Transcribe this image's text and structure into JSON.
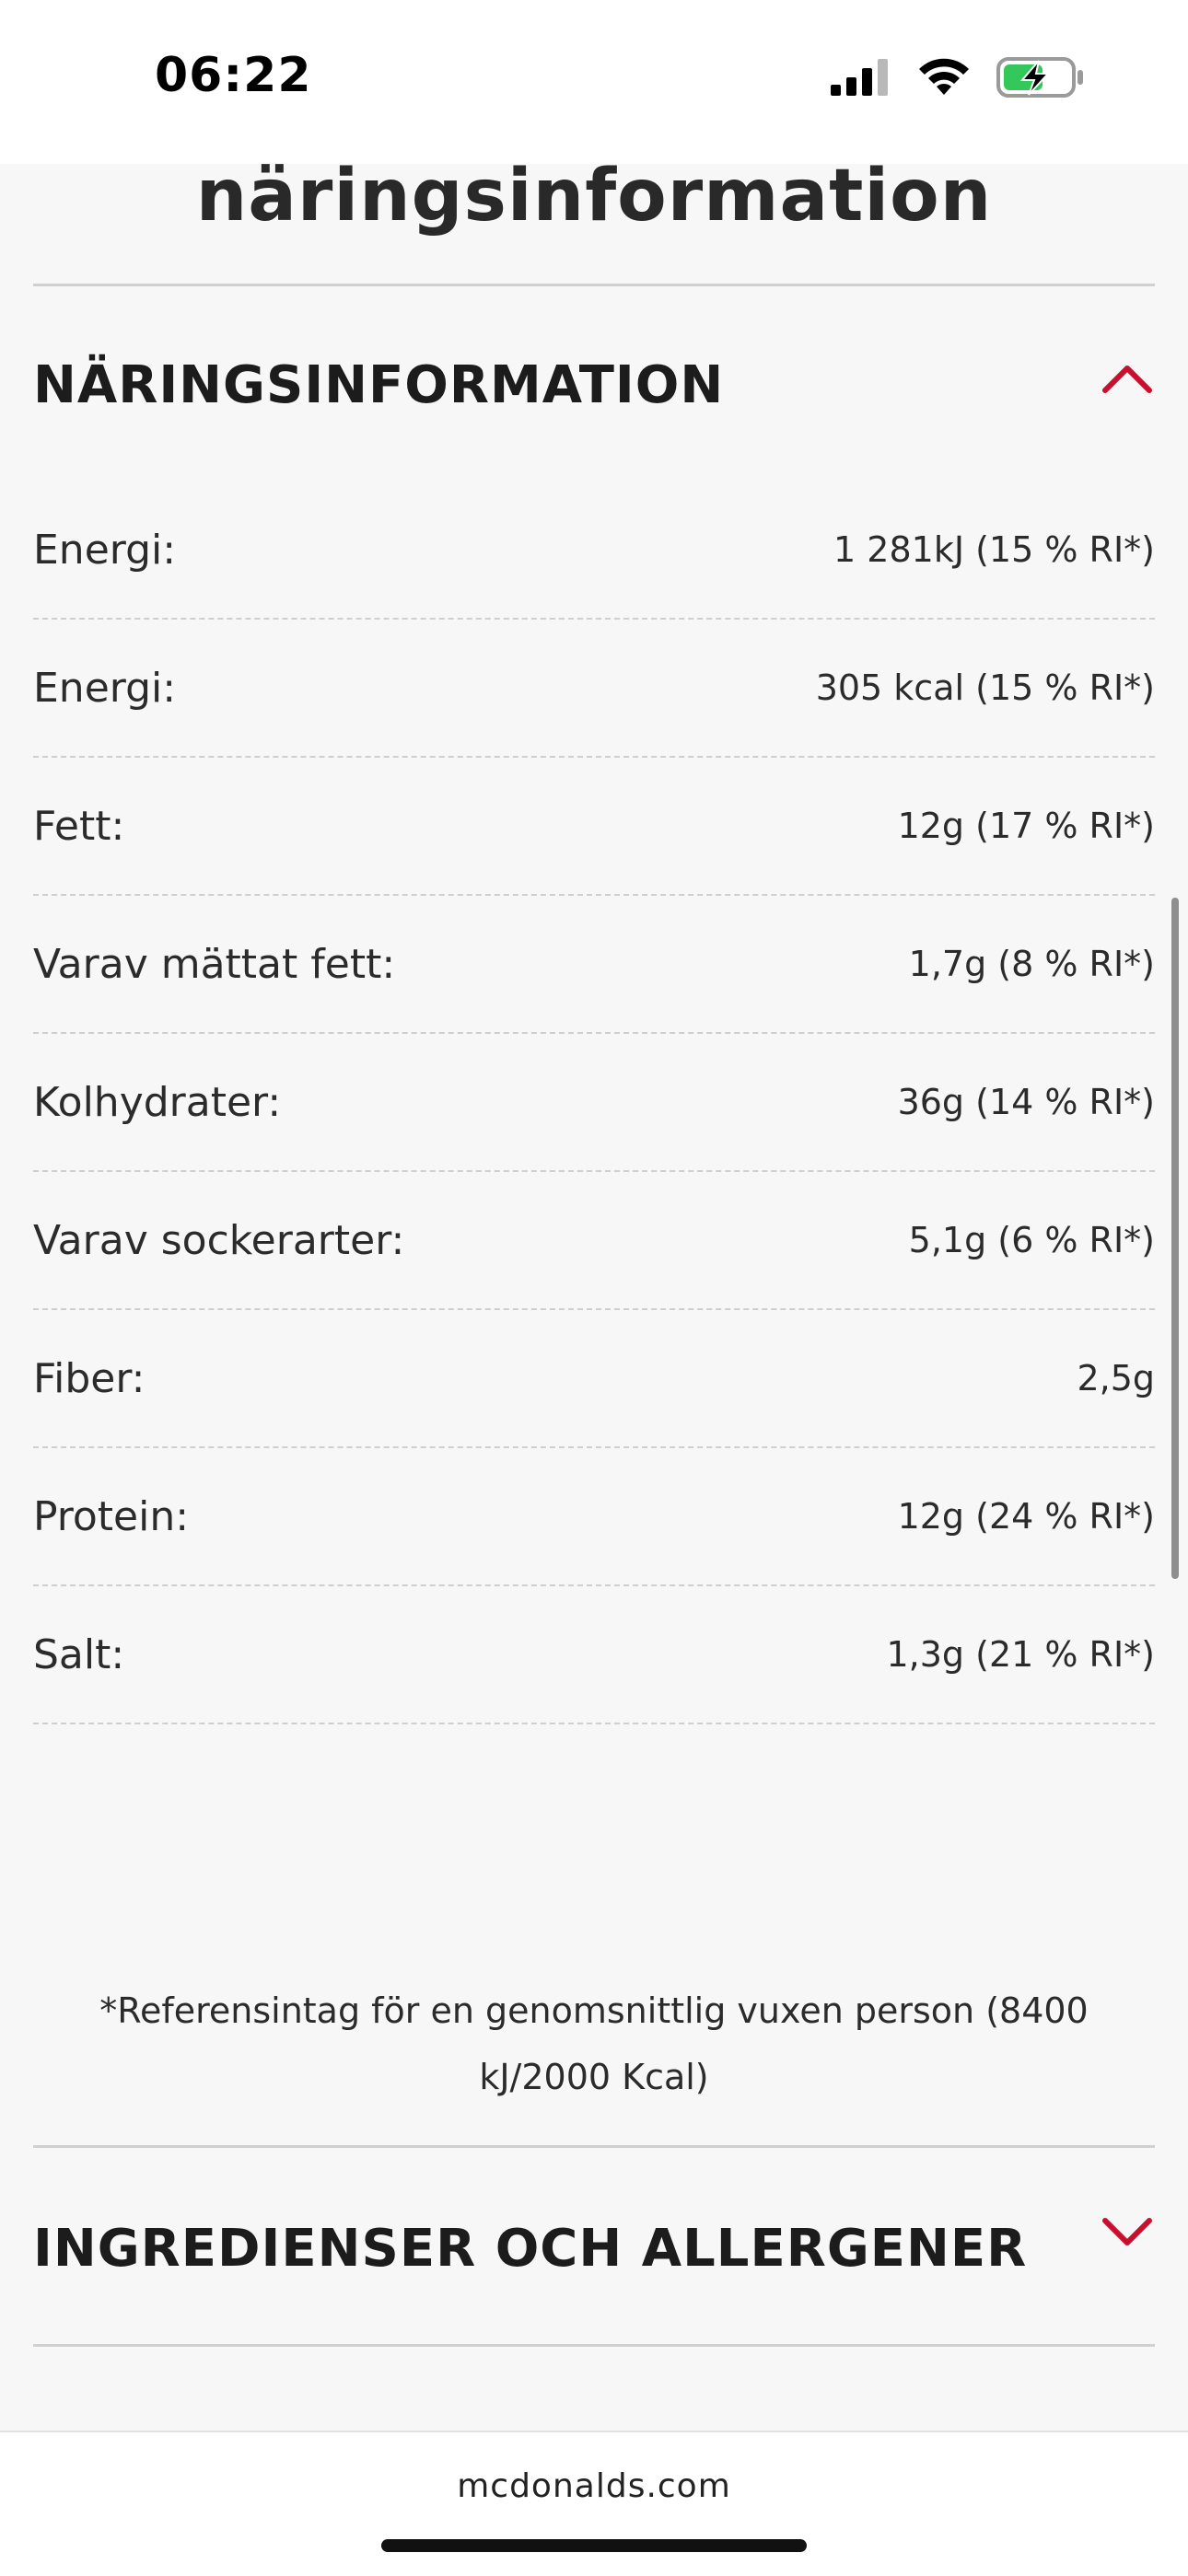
{
  "status_bar": {
    "time": "06:22"
  },
  "page": {
    "heading": "näringsinformation"
  },
  "nutrition_section": {
    "title": "NÄRINGSINFORMATION",
    "expanded": true,
    "rows": [
      {
        "label": "Energi:",
        "value": "1 281kJ (15 % RI*)"
      },
      {
        "label": "Energi:",
        "value": "305 kcal (15 % RI*)"
      },
      {
        "label": "Fett:",
        "value": "12g (17 % RI*)"
      },
      {
        "label": "Varav mättat fett:",
        "value": "1,7g (8 % RI*)"
      },
      {
        "label": "Kolhydrater:",
        "value": "36g (14 % RI*)"
      },
      {
        "label": "Varav sockerarter:",
        "value": "5,1g (6 % RI*)"
      },
      {
        "label": "Fiber:",
        "value": "2,5g"
      },
      {
        "label": "Protein:",
        "value": "12g (24 % RI*)"
      },
      {
        "label": "Salt:",
        "value": "1,3g (21 % RI*)"
      }
    ],
    "footnote": "*Referensintag för en genomsnittlig vuxen person (8400 kJ/2000 Kcal)"
  },
  "ingredients_section": {
    "title": "INGREDIENSER OCH ALLERGENER",
    "expanded": false
  },
  "browser": {
    "url": "mcdonalds.com"
  },
  "colors": {
    "accent_red": "#c8102e",
    "battery_green": "#34c759",
    "page_background": "#f7f7f7"
  },
  "icons": [
    "cellular-signal-icon",
    "wifi-icon",
    "battery-charging-icon",
    "chevron-up-icon",
    "chevron-down-icon"
  ]
}
